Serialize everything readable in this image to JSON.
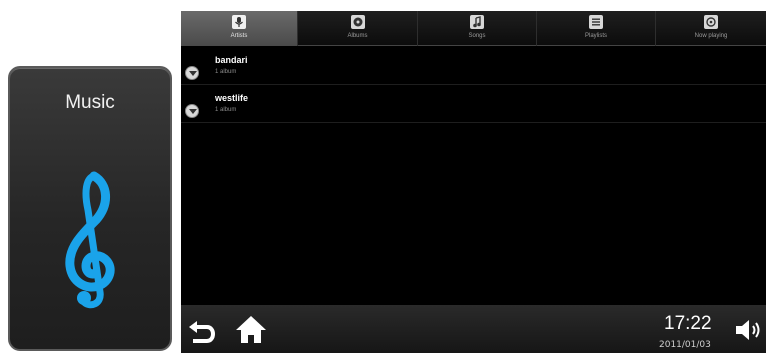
{
  "widget": {
    "title": "Music",
    "icon": "treble-clef-icon",
    "icon_color": "#1aa3ea"
  },
  "tabs": [
    {
      "label": "Artists",
      "icon": "microphone-icon",
      "active": true
    },
    {
      "label": "Albums",
      "icon": "album-icon",
      "active": false
    },
    {
      "label": "Songs",
      "icon": "music-note-icon",
      "active": false
    },
    {
      "label": "Playlists",
      "icon": "playlist-icon",
      "active": false
    },
    {
      "label": "Now playing",
      "icon": "now-playing-icon",
      "active": false
    }
  ],
  "artists": [
    {
      "name": "bandari",
      "albums": "1 album"
    },
    {
      "name": "westlife",
      "albums": "1 album"
    }
  ],
  "statusbar": {
    "time": "17:22",
    "date": "2011/01/03"
  },
  "colors": {
    "accent": "#1aa3ea",
    "background": "#000000"
  }
}
